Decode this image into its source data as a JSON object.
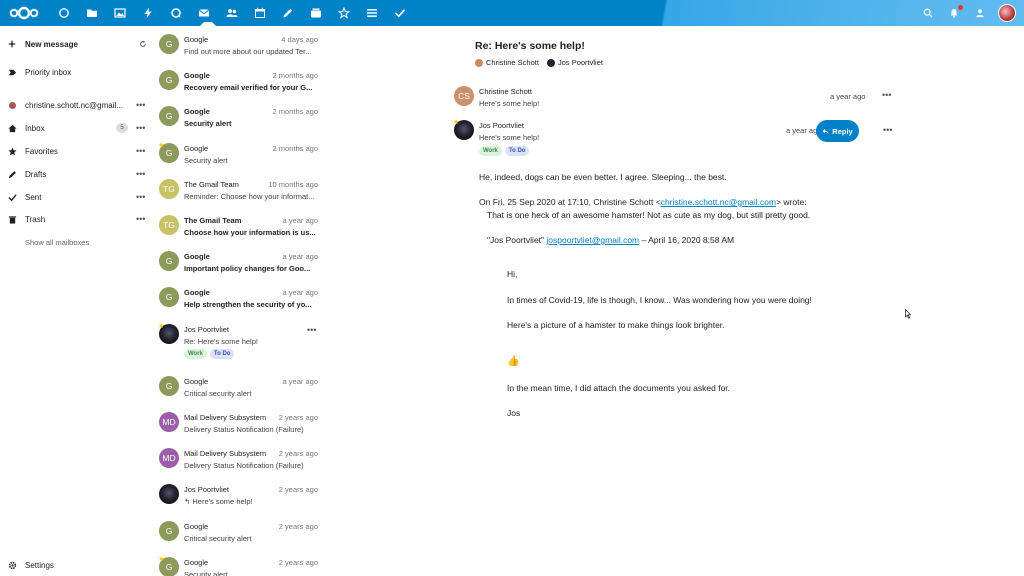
{
  "colors": {
    "brand": "#0082c9",
    "work_tag": "#d9f3dc",
    "todo_tag": "#d9e2fa"
  },
  "topbar": {
    "apps": [
      "dashboard-icon",
      "files-icon",
      "photos-icon",
      "activity-icon",
      "talk-icon",
      "mail-icon",
      "contacts-icon",
      "calendar-icon",
      "notes-icon",
      "deck-icon",
      "starred-icon",
      "tasks-icon",
      "checkmark-icon"
    ]
  },
  "nav": {
    "new_message": "New message",
    "priority_inbox": "Priority inbox",
    "account": "christine.schott.nc@gmail...",
    "inbox": "Inbox",
    "inbox_count": "5",
    "favorites": "Favorites",
    "drafts": "Drafts",
    "sent": "Sent",
    "trash": "Trash",
    "show_all": "Show all mailboxes",
    "settings": "Settings"
  },
  "messages": [
    {
      "initial": "G",
      "from": "Google",
      "date": "4 days ago",
      "subject": "Find out more about our updated Ter...",
      "unread": false,
      "color": "#8e9a5c"
    },
    {
      "initial": "G",
      "from": "Google",
      "date": "2 months ago",
      "subject": "Recovery email verified for your G...",
      "unread": true,
      "color": "#8e9a5c"
    },
    {
      "initial": "G",
      "from": "Google",
      "date": "2 months ago",
      "subject": "Security alert",
      "unread": true,
      "color": "#8e9a5c"
    },
    {
      "initial": "G",
      "from": "Google",
      "date": "2 months ago",
      "subject": "Security alert",
      "unread": false,
      "color": "#8e9a5c",
      "star": true
    },
    {
      "initial": "TG",
      "from": "The Gmail Team",
      "date": "10 months ago",
      "subject": "Reminder: Choose how your informat...",
      "unread": false,
      "color": "#c9c165"
    },
    {
      "initial": "TG",
      "from": "The Gmail Team",
      "date": "a year ago",
      "subject": "Choose how your information is us...",
      "unread": true,
      "color": "#c9c165"
    },
    {
      "initial": "G",
      "from": "Google",
      "date": "a year ago",
      "subject": "Important policy changes for Goo...",
      "unread": true,
      "color": "#8e9a5c"
    },
    {
      "initial": "G",
      "from": "Google",
      "date": "a year ago",
      "subject": "Help strengthen the security of yo...",
      "unread": true,
      "color": "#8e9a5c"
    },
    {
      "initial": "",
      "from": "Jos Poortvliet",
      "date": "",
      "subject": "Re: Here's some help!",
      "unread": false,
      "photo": true,
      "star": true,
      "tags": [
        "Work",
        "To Do"
      ],
      "selected": true
    },
    {
      "initial": "G",
      "from": "Google",
      "date": "a year ago",
      "subject": "Critical security alert",
      "unread": false,
      "color": "#8e9a5c"
    },
    {
      "initial": "MD",
      "from": "Mail Delivery Subsystem",
      "date": "2 years ago",
      "subject": "Delivery Status Notification (Failure)",
      "unread": false,
      "color": "#9b5fa8"
    },
    {
      "initial": "MD",
      "from": "Mail Delivery Subsystem",
      "date": "2 years ago",
      "subject": "Delivery Status Notification (Failure)",
      "unread": false,
      "color": "#9b5fa8"
    },
    {
      "initial": "",
      "from": "Jos Poortvliet",
      "date": "2 years ago",
      "subject": "↰ Here's some help!",
      "unread": false,
      "photo": true
    },
    {
      "initial": "G",
      "from": "Google",
      "date": "2 years ago",
      "subject": "Critical security alert",
      "unread": false,
      "color": "#8e9a5c"
    },
    {
      "initial": "G",
      "from": "Google",
      "date": "2 years ago",
      "subject": "Security alert",
      "unread": false,
      "color": "#8e9a5c",
      "star": true
    }
  ],
  "reader": {
    "subject": "Re: Here's some help!",
    "participants": [
      "Christine Schott",
      "Jos Poortvliet"
    ],
    "thread": [
      {
        "initials": "CS",
        "from": "Christine Schott",
        "snippet": "Here's some help!",
        "date": "a year ago"
      },
      {
        "initials": "",
        "from": "Jos Poortvliet",
        "snippet": "Here's some help!",
        "date": "a year ago",
        "tags": [
          "Work",
          "To Do"
        ]
      }
    ],
    "reply_label": "Reply",
    "body_line1": "He, indeed, dogs can be even better. I agree. Sleeping... the best.",
    "quote_header_pre": "On Fri, 25 Sep 2020 at 17:10, Christine Schott <",
    "quote_header_email": "christine.schott.nc@gmail.com",
    "quote_header_post": "> wrote:",
    "quote_line1": "That is one heck of an awesome hamster! Not as cute as my dog, but still pretty good.",
    "quote2_pre": "\"Jos Poortvliet\" ",
    "quote2_email": "jospoortvliet@gmail.com",
    "quote2_post": " – April 16, 2020 8:58 AM",
    "q_hi": "Hi,",
    "q_line2": "In times of Covid-19, life is though, I know... Was wondering how you were doing!",
    "q_line3": "Here's a picture of a hamster to make things look brighter.",
    "q_emoji": "👍",
    "q_line4": "In the mean time, I did attach the documents you asked for.",
    "q_sign": "Jos"
  }
}
